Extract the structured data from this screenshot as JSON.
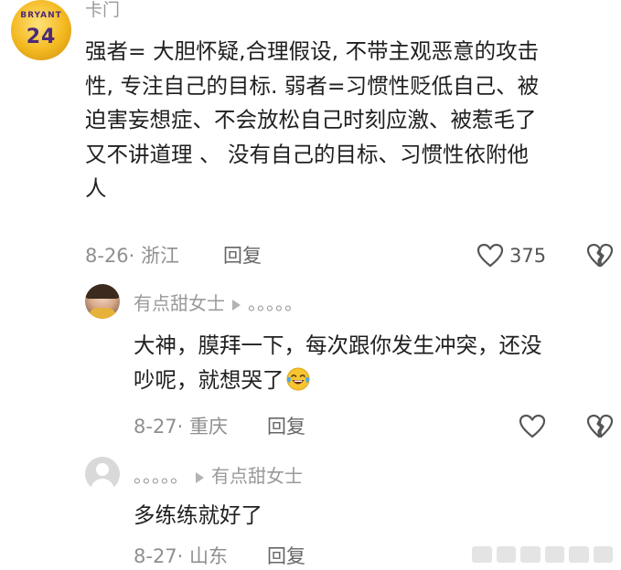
{
  "main_comment": {
    "username": "卡门",
    "avatar_jersey_name": "BRYANT",
    "avatar_jersey_number": "24",
    "lines": [
      "强者= 大胆怀疑,合理假设, 不带主观恶意的攻击",
      "性, 专注自己的目标. 弱者=习惯性贬低自己、被",
      "迫害妄想症、不会放松自己时刻应激、被惹毛了",
      "又不讲道理 、 没有自己的目标、习惯性依附他",
      "人"
    ],
    "meta": "8-26· 浙江",
    "reply_label": "回复",
    "like_count": "375",
    "icons": {
      "like": "heart-outline-icon",
      "dislike": "broken-heart-icon"
    }
  },
  "replies": [
    {
      "username": "有点甜女士",
      "reply_to": "。。。。。",
      "lines": [
        "大神，膜拜一下，每次跟你发生冲突，还没",
        "吵呢，就想哭了"
      ],
      "emoji": "tears-of-joy-emoji",
      "meta": "8-27· 重庆",
      "reply_label": "回复"
    },
    {
      "username": "。。。。。",
      "reply_to": "有点甜女士",
      "lines": [
        "多练练就好了"
      ],
      "meta": "8-27· 山东",
      "reply_label": "回复"
    }
  ],
  "colors": {
    "text": "#1f1f1f",
    "meta": "#8f8f8f",
    "username": "#9a9a9a",
    "icon": "#555555"
  }
}
